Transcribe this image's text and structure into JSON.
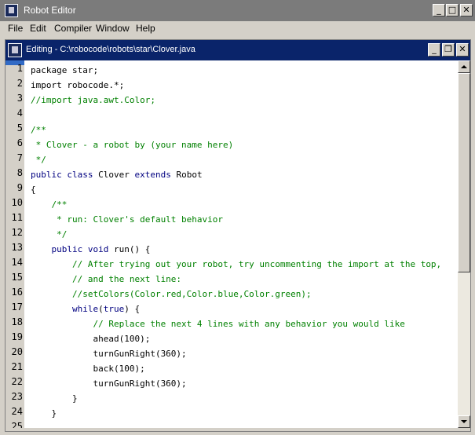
{
  "app": {
    "title": "Robot Editor"
  },
  "window_controls": {
    "minimize": "_",
    "maximize": "□",
    "close": "✕"
  },
  "menu": [
    "File",
    "Edit",
    "Compiler",
    "Window",
    "Help"
  ],
  "editor_window": {
    "title": "Editing - C:\\robocode\\robots\\star\\Clover.java",
    "controls": {
      "minimize": "_",
      "restore": "❐",
      "close": "✕"
    }
  },
  "line_numbers": [
    "1",
    "2",
    "3",
    "4",
    "5",
    "6",
    "7",
    "8",
    "9",
    "10",
    "11",
    "12",
    "13",
    "14",
    "15",
    "16",
    "17",
    "18",
    "19",
    "20",
    "21",
    "22",
    "23",
    "24",
    "25"
  ],
  "code": [
    [
      {
        "t": "tx",
        "v": "package star;"
      }
    ],
    [
      {
        "t": "tx",
        "v": "import robocode.*;"
      }
    ],
    [
      {
        "t": "cm",
        "v": "//import java.awt.Color;"
      }
    ],
    [],
    [
      {
        "t": "cm",
        "v": "/**"
      }
    ],
    [
      {
        "t": "cm",
        "v": " * Clover - a robot by (your name here)"
      }
    ],
    [
      {
        "t": "cm",
        "v": " */"
      }
    ],
    [
      {
        "t": "kw",
        "v": "public class"
      },
      {
        "t": "tx",
        "v": " Clover "
      },
      {
        "t": "kw",
        "v": "extends"
      },
      {
        "t": "tx",
        "v": " Robot"
      }
    ],
    [
      {
        "t": "tx",
        "v": "{"
      }
    ],
    [
      {
        "t": "cm",
        "v": "    /**"
      }
    ],
    [
      {
        "t": "cm",
        "v": "     * run: Clover's default behavior"
      }
    ],
    [
      {
        "t": "cm",
        "v": "     */"
      }
    ],
    [
      {
        "t": "kw",
        "v": "    public void"
      },
      {
        "t": "tx",
        "v": " run() {"
      }
    ],
    [
      {
        "t": "cm",
        "v": "        // After trying out your robot, try uncommenting the import at the top,"
      }
    ],
    [
      {
        "t": "cm",
        "v": "        // and the next line:"
      }
    ],
    [
      {
        "t": "cm",
        "v": "        //setColors(Color.red,Color.blue,Color.green);"
      }
    ],
    [
      {
        "t": "kw",
        "v": "        while"
      },
      {
        "t": "tx",
        "v": "("
      },
      {
        "t": "kw",
        "v": "true"
      },
      {
        "t": "tx",
        "v": ") {"
      }
    ],
    [
      {
        "t": "cm",
        "v": "            // Replace the next 4 lines with any behavior you would like"
      }
    ],
    [
      {
        "t": "tx",
        "v": "            ahead(100);"
      }
    ],
    [
      {
        "t": "tx",
        "v": "            turnGunRight(360);"
      }
    ],
    [
      {
        "t": "tx",
        "v": "            back(100);"
      }
    ],
    [
      {
        "t": "tx",
        "v": "            turnGunRight(360);"
      }
    ],
    [
      {
        "t": "tx",
        "v": "        }"
      }
    ],
    [
      {
        "t": "tx",
        "v": "    }"
      }
    ],
    []
  ],
  "colors": {
    "keyword": "#000080",
    "comment": "#008000",
    "text": "#000000",
    "title_active": "#0a246a",
    "title_inactive": "#7b7b7b"
  }
}
